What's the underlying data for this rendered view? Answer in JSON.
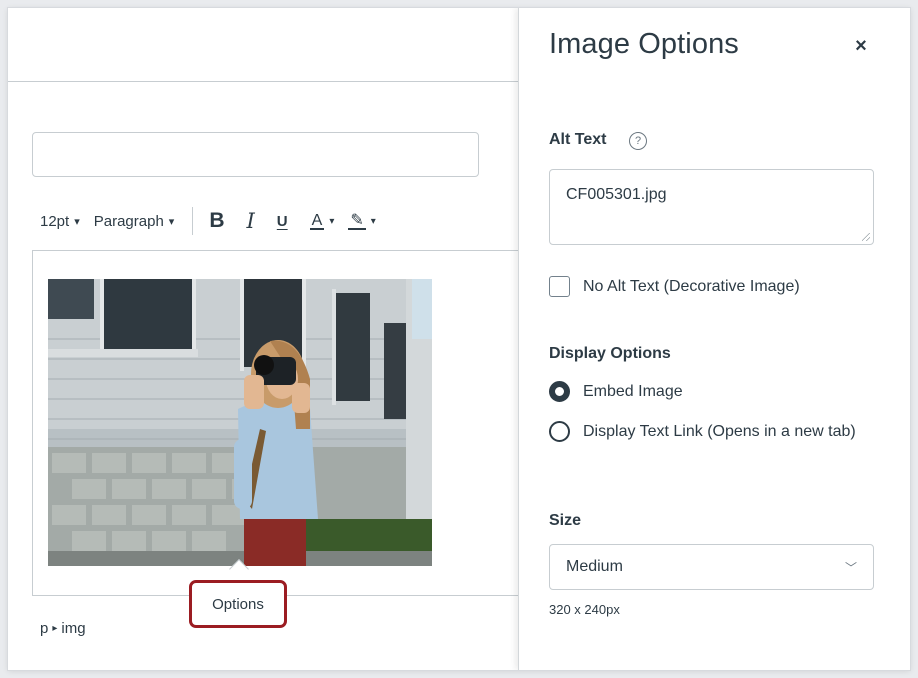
{
  "editor": {
    "toolbar": {
      "font_size": "12pt",
      "block_format": "Paragraph",
      "bold_label": "B",
      "italic_label": "I",
      "underline_label": "U",
      "text_color_label": "A",
      "highlight_label": "✎"
    },
    "image_alt": "CF005301.jpg",
    "options_button": "Options",
    "path": {
      "parent": "p",
      "child": "img"
    }
  },
  "tray": {
    "title": "Image Options",
    "close_glyph": "×",
    "alt_text_label": "Alt Text",
    "help_glyph": "?",
    "alt_text_value": "CF005301.jpg",
    "no_alt_label": "No Alt Text (Decorative Image)",
    "display_options_label": "Display Options",
    "embed_label": "Embed Image",
    "link_label": "Display Text Link (Opens in a new tab)",
    "size_label": "Size",
    "size_value": "Medium",
    "dimensions": "320 x 240px"
  },
  "icons": {
    "chevron": "chevron-down-icon",
    "close": "close-icon",
    "help": "help-circle-icon",
    "path_arrow": "caret-right-icon"
  },
  "colors": {
    "text": "#2d3b45",
    "border": "#c7cdd1",
    "highlight_border": "#9b1c22"
  }
}
